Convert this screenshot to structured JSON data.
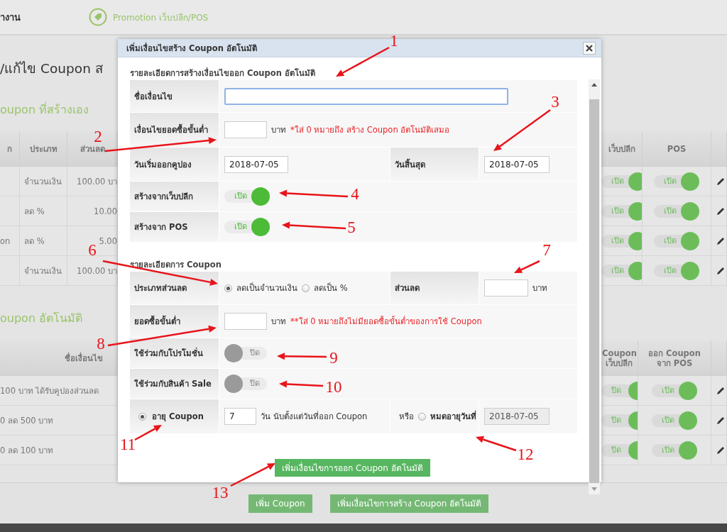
{
  "top_bar": {
    "title": "างาน",
    "menu_item": "Promotion เว็บปลีก/POS"
  },
  "page_title": "/แก้ไข Coupon ส",
  "manual_section": {
    "title": "oupon ที่สร้างเอง",
    "column_1": "ก",
    "type_column": "ประเภท",
    "discount_column": "ส่วนลด",
    "web_column": "เว็บปลีก",
    "pos_column": "POS",
    "rows": [
      {
        "type": "จำนวนเงิน",
        "discount": "100.00 บา",
        "web": {
          "on": true,
          "text": "เปิด"
        },
        "pos": {
          "on": true,
          "text": "เปิด"
        }
      },
      {
        "type": "ลด %",
        "discount": "10.00",
        "web": {
          "on": true,
          "text": "เปิด"
        },
        "pos": {
          "on": true,
          "text": "เปิด"
        }
      },
      {
        "column_1": "on",
        "type": "ลด %",
        "discount": "5.00",
        "web": {
          "on": true,
          "text": "เปิด"
        },
        "pos": {
          "on": true,
          "text": "เปิด"
        }
      },
      {
        "type": "จำนวนเงิน",
        "discount": "100.00 บา",
        "web": {
          "on": true,
          "text": "เปิด"
        },
        "pos": {
          "on": true,
          "text": "เปิด"
        }
      }
    ]
  },
  "auto_section": {
    "title": "oupon อัตโนมัติ",
    "name_column": "ชื่อเงื่อนไข",
    "web_column": [
      "Coupon",
      "เว็บปลีก"
    ],
    "pos_column": [
      "ออก Coupon",
      "จาก POS"
    ],
    "rows": [
      {
        "name": "100 บาท ได้รับคูปองส่วนลด",
        "web": {
          "on": true,
          "text": "ปิด"
        },
        "pos": {
          "on": true,
          "text": "เปิด"
        }
      },
      {
        "name": "0 ลด 500 บาท",
        "web": {
          "on": true,
          "text": "ปิด"
        },
        "pos": {
          "on": true,
          "text": "เปิด"
        }
      },
      {
        "name": "0 ลด 100 บาท",
        "web": {
          "on": true,
          "text": "ปิด"
        },
        "pos": {
          "on": true,
          "text": "เปิด"
        }
      }
    ]
  },
  "bottom_buttons": [
    "เพิ่ม Coupon",
    "เพิ่มเงื่อนไขการสร้าง Coupon อัตโนมัติ"
  ],
  "modal": {
    "title": "เพิ่มเงื่อนไขสร้าง Coupon อัตโนมัติ",
    "heading_1": "รายละเอียดการสร้างเงื่อนไขออก Coupon อัตโนมัติ",
    "condition_name": {
      "label": "ชื่อเงื่อนไข",
      "focused": true
    },
    "min_purchase": {
      "label": "เงื่อนไขยอดซื้อขั้นต่ำ",
      "unit": "บาท",
      "note": "*ใส่ 0 หมายถึง สร้าง Coupon อัตโนมัติเสมอ"
    },
    "dates": {
      "start_label": "วันเริ่มออกคูปอง",
      "start_value": "2018-07-05",
      "end_label": "วันสิ้นสุด",
      "end_value": "2018-07-05"
    },
    "from_web": {
      "label": "สร้างจากเว็บปลีก",
      "toggle": {
        "on": true,
        "text": "เปิด"
      }
    },
    "from_pos": {
      "label": "สร้างจาก POS",
      "toggle": {
        "on": true,
        "text": "เปิด"
      }
    },
    "heading_2": "รายละเอียดการ Coupon",
    "discount_type": {
      "label": "ประเภทส่วนลด",
      "options": [
        {
          "label": "ลดเป็นจำนวนเงิน",
          "selected": true
        },
        {
          "label": "ลดเป็น %",
          "selected": false
        }
      ],
      "amount_label": "ส่วนลด",
      "amount_unit": "บาท"
    },
    "min_use": {
      "label": "ยอดซื้อขั้นต่ำ",
      "unit": "บาท",
      "note": "**ใส่ 0 หมายถึงไม่มียอดซื้อขั้นต่ำของการใช้ Coupon"
    },
    "with_promotion": {
      "label": "ใช้ร่วมกับโปรโมชั่น",
      "toggle": {
        "on": false,
        "text": "ปิด"
      }
    },
    "with_sale": {
      "label": "ใช้ร่วมกับสินค้า Sale",
      "toggle": {
        "on": false,
        "text": "ปิด"
      }
    },
    "expiry": {
      "lifetime": {
        "label": "อายุ Coupon",
        "selected": true,
        "value": "7",
        "suffix": "วัน นับตั้งแต่วันที่ออก Coupon"
      },
      "or_text": "หรือ",
      "until": {
        "label": "หมดอายุวันที่",
        "selected": false,
        "value": "2018-07-05",
        "disabled": true
      }
    },
    "submit_button": "เพิ่มเงื่อนไขการออก Coupon อัตโนมัติ"
  },
  "annotations": [
    {
      "label": "1"
    },
    {
      "label": "2"
    },
    {
      "label": "3"
    },
    {
      "label": "4"
    },
    {
      "label": "5"
    },
    {
      "label": "6"
    },
    {
      "label": "7"
    },
    {
      "label": "8"
    },
    {
      "label": "9"
    },
    {
      "label": "10"
    },
    {
      "label": "11"
    },
    {
      "label": "12"
    },
    {
      "label": "13"
    }
  ]
}
